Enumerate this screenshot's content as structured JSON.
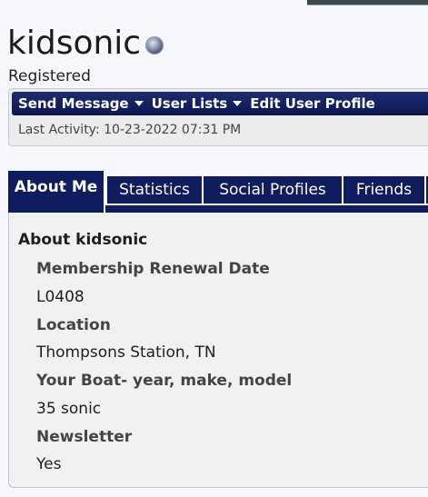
{
  "profile": {
    "username": "kidsonic",
    "user_title": "Registered",
    "status_icon": "offline-status-icon"
  },
  "actions": {
    "send_message": "Send Message",
    "user_lists": "User Lists",
    "edit_profile": "Edit User Profile",
    "last_activity_label": "Last Activity:",
    "last_activity_value": "10-23-2022 07:31 PM"
  },
  "tabs": [
    {
      "label": "About Me"
    },
    {
      "label": "Statistics"
    },
    {
      "label": "Social Profiles"
    },
    {
      "label": "Friends"
    }
  ],
  "about": {
    "title": "About kidsonic",
    "fields": [
      {
        "label": "Membership Renewal Date",
        "value": "L0408"
      },
      {
        "label": "Location",
        "value": "Thompsons Station, TN"
      },
      {
        "label": "Your Boat- year, make, model",
        "value": "35 sonic"
      },
      {
        "label": "Newsletter",
        "value": "Yes"
      }
    ]
  },
  "colors": {
    "nav_bg": "#0f1c5e",
    "page_bg": "#f5f7fc",
    "panel_bg": "#f1f1f1"
  }
}
